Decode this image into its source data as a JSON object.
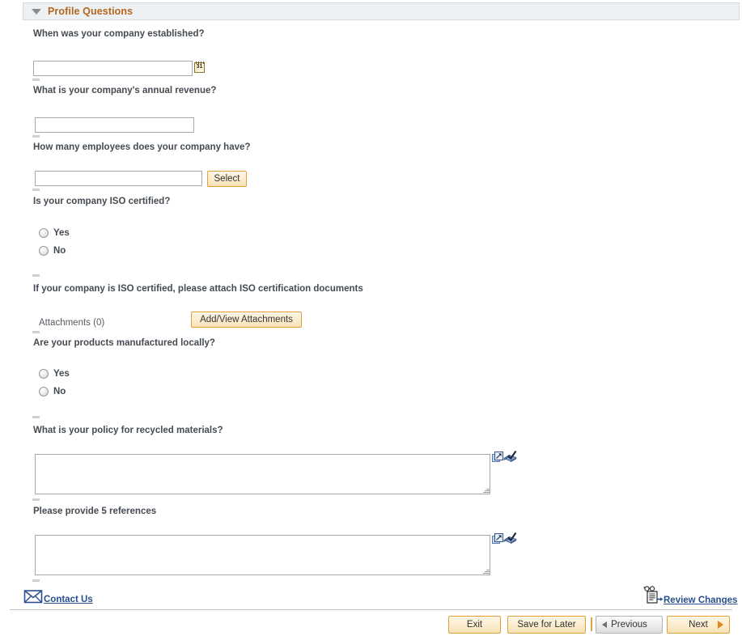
{
  "section": {
    "title": "Profile Questions",
    "collapse_icon": "collapse-triangle-down-icon"
  },
  "questions": [
    {
      "id": "established",
      "label": "When was your company established?",
      "type": "date",
      "value": "",
      "icon": "calendar-icon",
      "icon_text": "31"
    },
    {
      "id": "revenue",
      "label": "What is your company's annual revenue?",
      "type": "text",
      "value": ""
    },
    {
      "id": "employees",
      "label": "How many employees does your company have?",
      "type": "text-with-button",
      "value": "",
      "button_label": "Select"
    },
    {
      "id": "iso_certified",
      "label": "Is your company ISO certified?",
      "type": "radio",
      "options": [
        "Yes",
        "No"
      ],
      "selected": ""
    },
    {
      "id": "iso_attach",
      "label": "If your company is ISO certified, please attach ISO certification documents",
      "type": "attachment",
      "attachments_label": "Attachments (0)",
      "button_label": "Add/View Attachments"
    },
    {
      "id": "local_manufacture",
      "label": "Are your products manufactured locally?",
      "type": "radio",
      "options": [
        "Yes",
        "No"
      ],
      "selected": ""
    },
    {
      "id": "recycled_policy",
      "label": "What is your policy for recycled materials?",
      "type": "textarea",
      "value": ""
    },
    {
      "id": "references",
      "label": "Please provide 5 references",
      "type": "textarea",
      "value": ""
    }
  ],
  "textarea_tools": {
    "expand_icon": "expand-window-icon",
    "spellcheck_icon": "spell-check-icon"
  },
  "footer": {
    "contact_us": "Contact Us",
    "contact_icon": "envelope-icon",
    "review_changes": "Review Changes",
    "review_icon": "review-changes-icon"
  },
  "actions": {
    "exit": "Exit",
    "save_for_later": "Save for Later",
    "previous": "Previous",
    "next": "Next",
    "previous_icon": "triangle-left-icon",
    "next_icon": "triangle-right-icon"
  },
  "colors": {
    "accent": "#b5651d",
    "button_border": "#e39f3a",
    "link": "#2a4f8f",
    "header_bg": "#eef1f3"
  }
}
